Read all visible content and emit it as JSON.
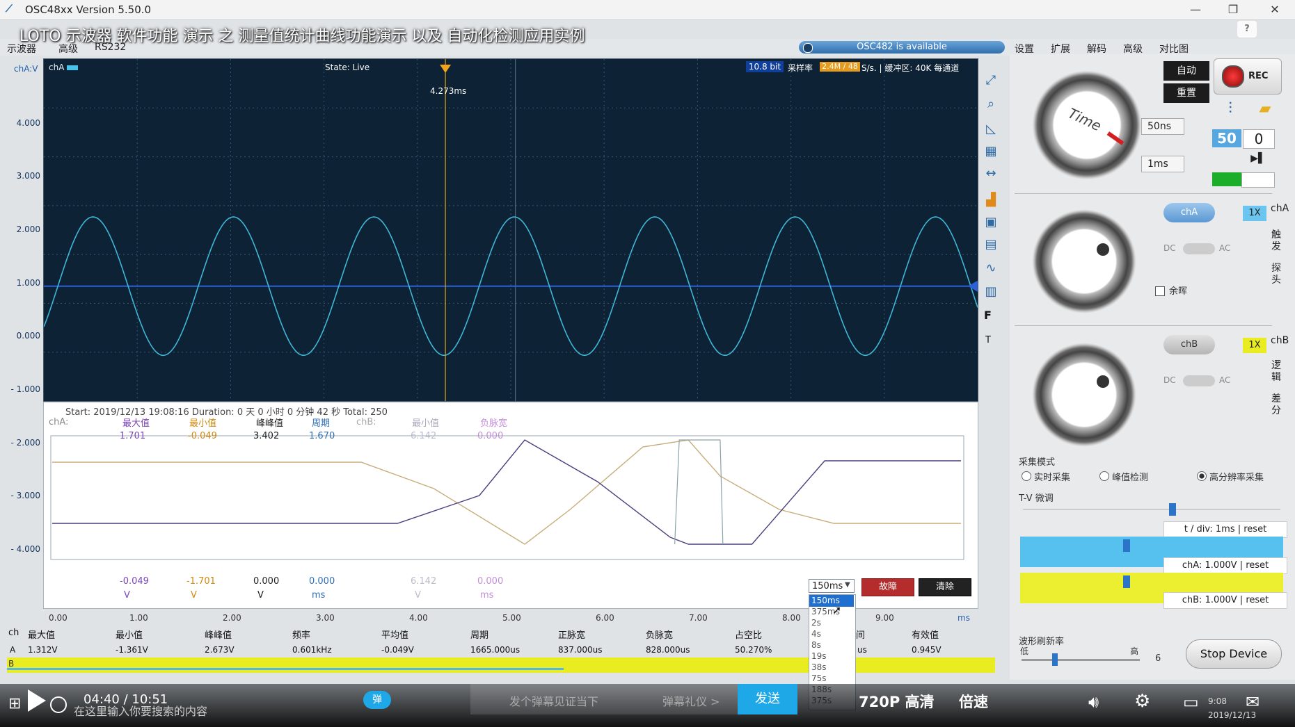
{
  "window": {
    "title": "OSC48xx  Version 5.50.0",
    "btn_min": "—",
    "btn_max": "❐",
    "btn_close": "✕"
  },
  "video_title": "LOTO 示波器 软件功能 演示 之 测量值统计曲线功能演示 以及 自动化检测应用实例",
  "menu": [
    "示波器",
    "高级",
    "RS232"
  ],
  "device_status": "OSC482  is available",
  "right_tabs": [
    "设置",
    "扩展",
    "解码",
    "高级",
    "对比图"
  ],
  "scope": {
    "ch_unit": "chA:V",
    "channel_label": "chA",
    "state": "State: Live",
    "bit_depth": "10.8 bit",
    "sample_label": "采样率",
    "sample_rate": "2.4M / 48",
    "sample_rest": "S/s. | 缓冲区: 40K 每通道",
    "cursor_time": "4.273ms",
    "y_ticks": [
      "4.000",
      "3.000",
      "2.000",
      "1.000",
      "0.000",
      "- 1.000",
      "- 2.000",
      "- 3.000",
      "- 4.000"
    ],
    "channel_marker": "A",
    "F": "F",
    "T": "T",
    "sine": {
      "amplitude": 1.3,
      "offset": 0.0,
      "periods_visible": 6.65,
      "phase": 0.15
    }
  },
  "stats": {
    "start_line": "Start: 2019/12/13 19:08:16  Duration: 0 天 0 小时 0 分钟 42 秒  Total: 250",
    "cha": "chA:",
    "chb": "chB:",
    "headers": [
      "最大值",
      "最小值",
      "峰峰值",
      "周期",
      "最小值",
      "负脉宽"
    ],
    "top_values": [
      "1.701",
      "-0.049",
      "3.402",
      "1.670",
      "6.142",
      "0.000"
    ],
    "bottom_values": [
      "-0.049",
      "-1.701",
      "0.000",
      "0.000",
      "6.142",
      "0.000"
    ],
    "units": [
      "V",
      "V",
      "V",
      "ms",
      "V",
      "ms"
    ],
    "range_selected": "150ms",
    "range_options": [
      "150ms",
      "375ms",
      "2s",
      "4s",
      "8s",
      "19s",
      "38s",
      "75s",
      "188s",
      "375s"
    ],
    "fault_label": "故障",
    "clear_label": "清除"
  },
  "x_axis": {
    "ticks": [
      "0.00",
      "1.00",
      "2.00",
      "3.00",
      "4.00",
      "5.00",
      "6.00",
      "7.00",
      "8.00",
      "9.00"
    ],
    "unit": "ms"
  },
  "measure": {
    "headers": [
      "ch",
      "最大值",
      "最小值",
      "峰峰值",
      "频率",
      "平均值",
      "周期",
      "正脉宽",
      "负脉宽",
      "占空比",
      "间",
      "有效值"
    ],
    "row": [
      "A",
      "1.312V",
      "-1.361V",
      "2.673V",
      "0.601kHz",
      "-0.049V",
      "1665.000us",
      "837.000us",
      "828.000us",
      "50.270%",
      "us",
      "0.945V"
    ],
    "b_label": "B"
  },
  "right_panel": {
    "auto": "自动",
    "reset": "重置",
    "rec": "REC",
    "time_knob_label": "Time",
    "time_sel_1": "50ns",
    "time_sel_2": "1ms",
    "num_left": "50",
    "num_right": "0",
    "cha_toggle": "chA",
    "chb_toggle": "chB",
    "x1_a": "1X",
    "x1_b": "1X",
    "dc": "DC",
    "ac": "AC",
    "afterglow": "余晖",
    "side_tabs_a": [
      "chA",
      "触发",
      "探头"
    ],
    "side_tabs_b": [
      "chB",
      "逻辑",
      "差分"
    ],
    "acq_title": "采集模式",
    "acq_modes": [
      "实时采集",
      "峰值检测",
      "高分辨率采集"
    ],
    "tv_title": "T-V 微调",
    "tdiv": "t / div: 1ms | reset",
    "cha_v": "chA: 1.000V | reset",
    "chb_v": "chB: 1.000V | reset",
    "refresh_title": "波形刷新率",
    "refresh_low": "低",
    "refresh_high": "高",
    "refresh_val": "6",
    "stop": "Stop Device"
  },
  "video_bar": {
    "time": "04:40  /  10:51",
    "danmaku_badge": "弹",
    "placeholder": "发个弹幕见证当下",
    "gift": "弹幕礼仪 >",
    "send": "发送",
    "quality": "720P 高清",
    "speed": "倍速",
    "search": "在这里输入你要搜索的内容",
    "clock": "9:08",
    "date": "2019/12/13"
  },
  "colors": {
    "scope_bg": "#0e2235",
    "trace_a": "#3fb7d6",
    "cursor": "#e0a020",
    "stat_purple": "#4c3e7e",
    "stat_tan": "#c7ad7a",
    "stat_gray": "#8aa3a8"
  }
}
